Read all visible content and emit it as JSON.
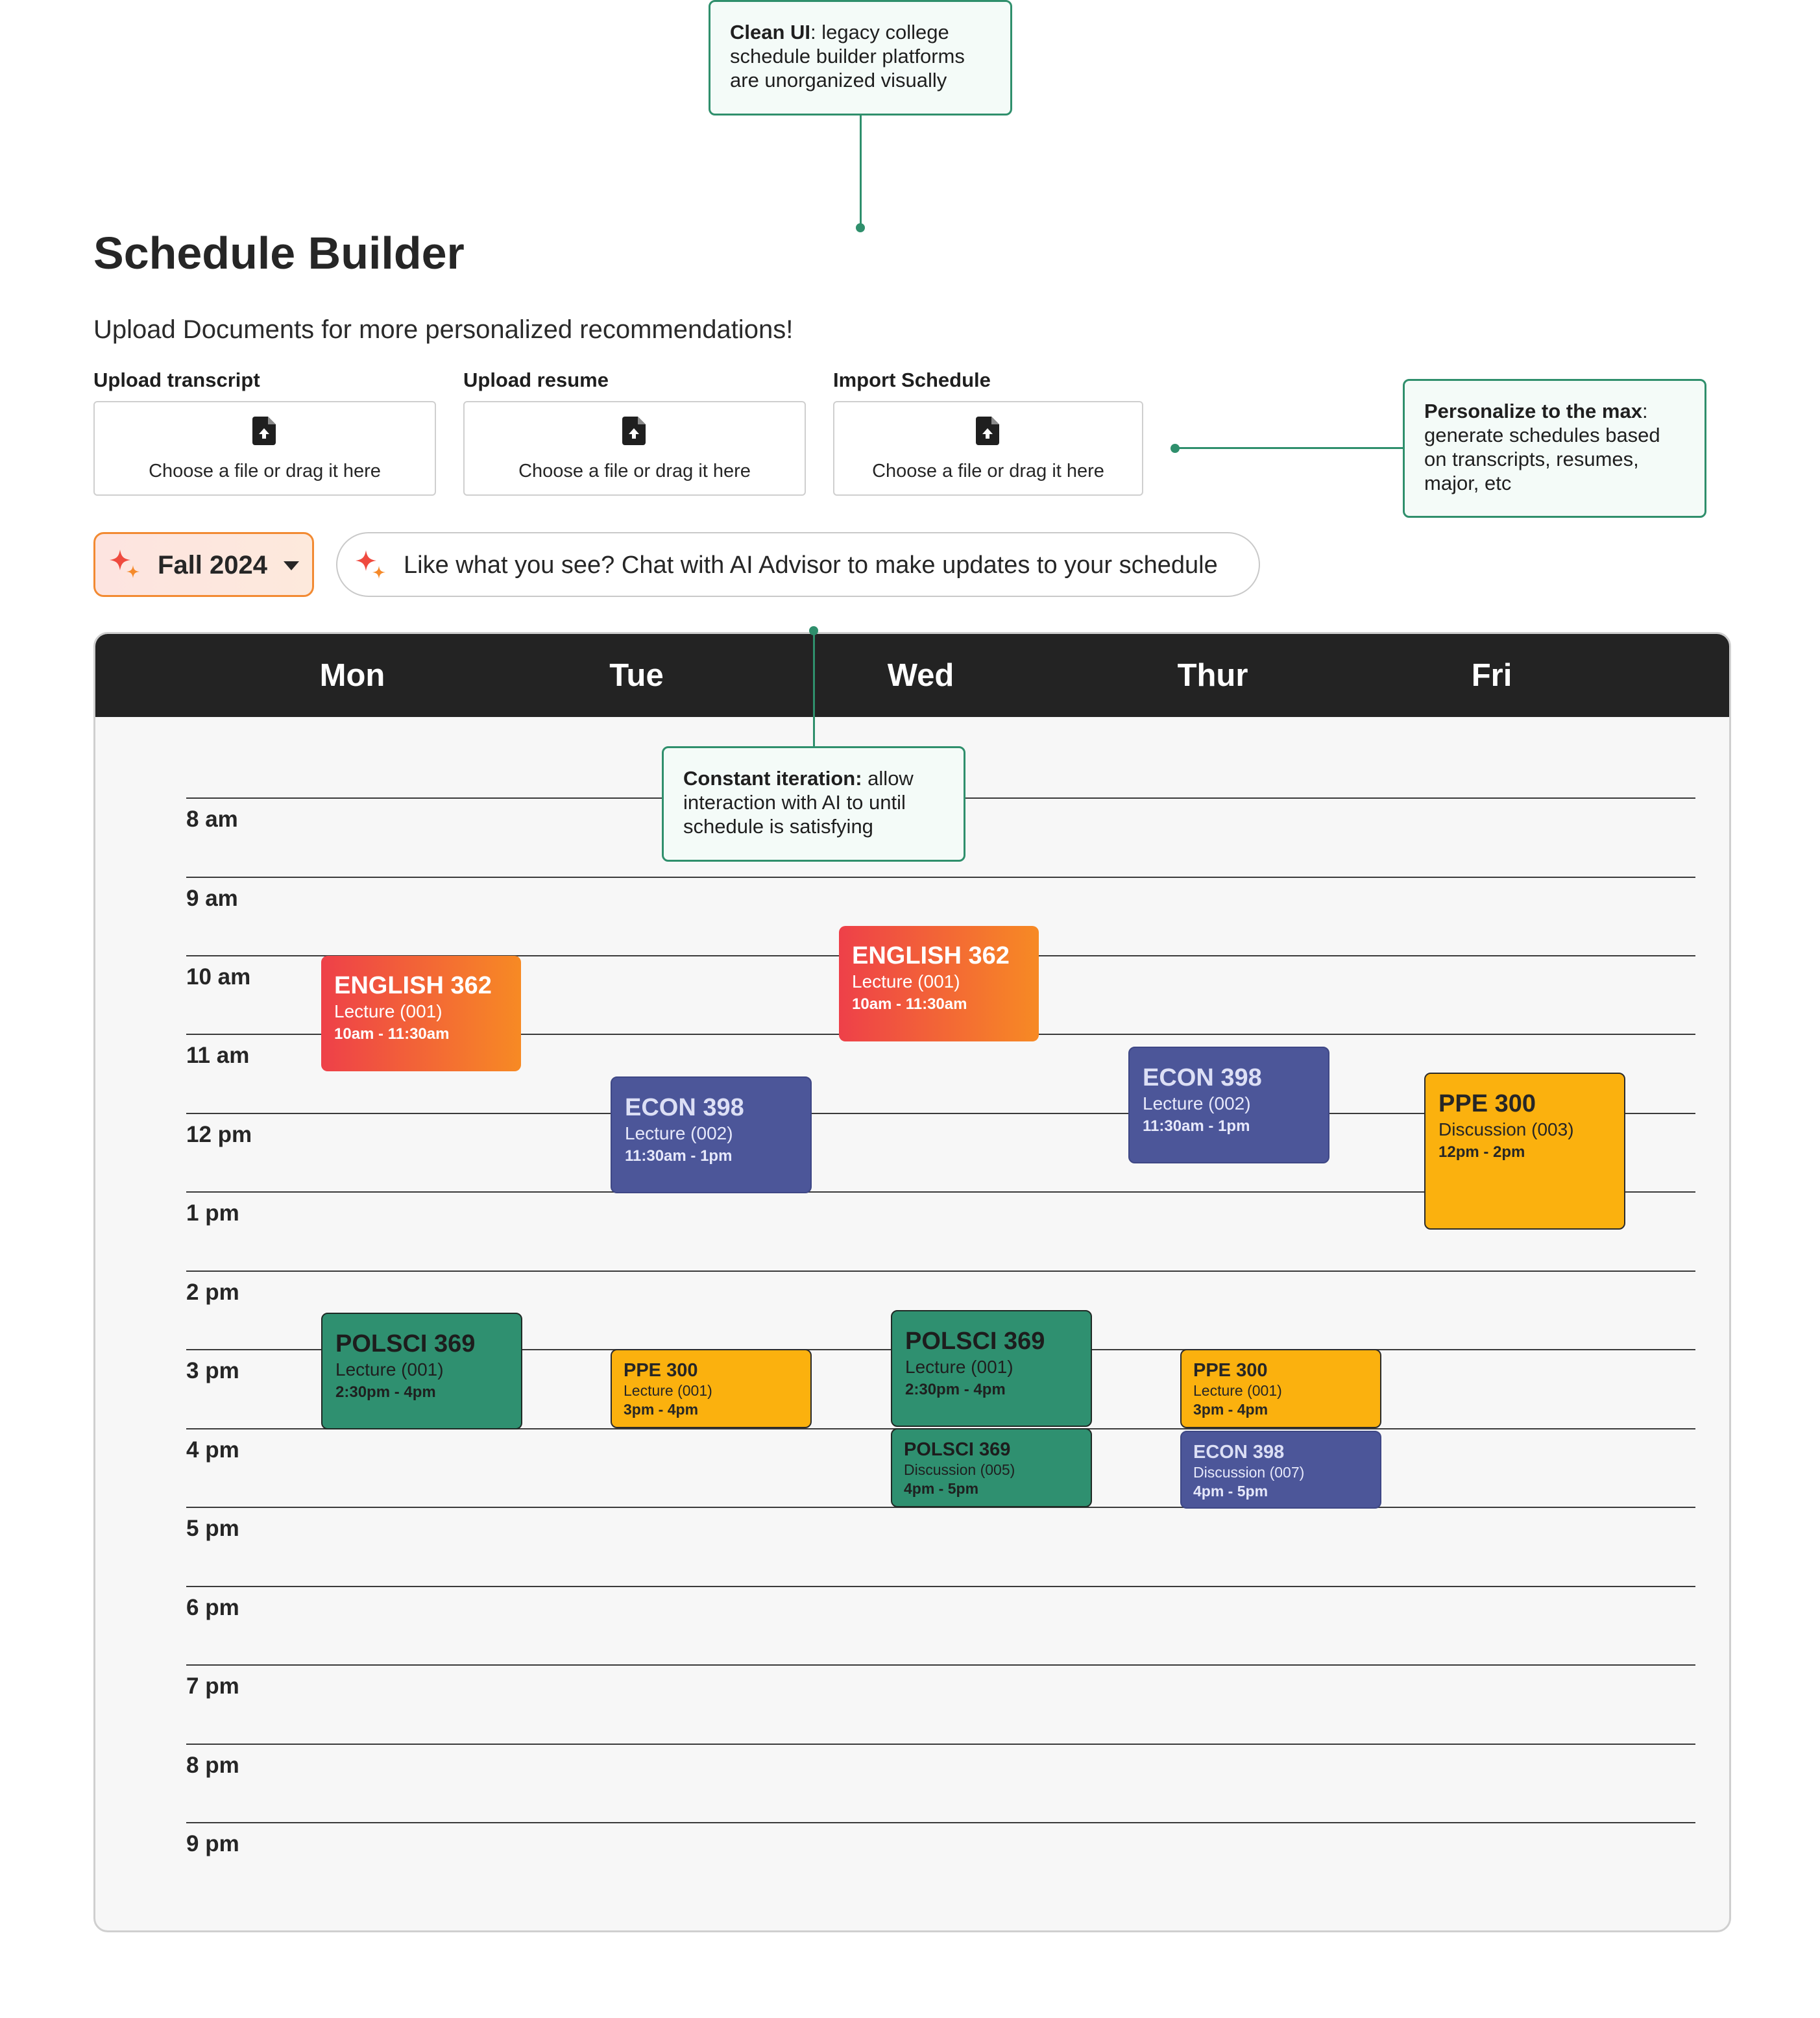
{
  "page": {
    "title": "Schedule Builder",
    "subtitle": "Upload Documents for more personalized recommendations!"
  },
  "uploads": [
    {
      "label": "Upload transcript",
      "prompt": "Choose a file or drag it here"
    },
    {
      "label": "Upload resume",
      "prompt": "Choose a file or drag it here"
    },
    {
      "label": "Import Schedule",
      "prompt": "Choose a file or drag it here"
    }
  ],
  "term": {
    "label": "Fall 2024",
    "icon": "sparkle-icon"
  },
  "chat": {
    "label": "Like what you see? Chat with AI Advisor to make updates to your schedule",
    "icon": "sparkle-icon"
  },
  "calendar": {
    "days": [
      "Mon",
      "Tue",
      "Wed",
      "Thur",
      "Fri"
    ],
    "hours": [
      "8 am",
      "9 am",
      "10 am",
      "11 am",
      "12 pm",
      "1 pm",
      "2 pm",
      "3 pm",
      "4 pm",
      "5 pm",
      "6 pm",
      "7 pm",
      "8 pm",
      "9 pm"
    ],
    "events": [
      {
        "code": "ENGLISH 362",
        "type": "Lecture (001)",
        "time": "10am - 11:30am"
      },
      {
        "code": "ENGLISH 362",
        "type": "Lecture (001)",
        "time": "10am - 11:30am"
      },
      {
        "code": "ECON 398",
        "type": "Lecture (002)",
        "time": "11:30am - 1pm"
      },
      {
        "code": "ECON 398",
        "type": "Lecture (002)",
        "time": "11:30am - 1pm"
      },
      {
        "code": "PPE 300",
        "type": "Discussion (003)",
        "time": "12pm - 2pm"
      },
      {
        "code": "POLSCI 369",
        "type": "Lecture (001)",
        "time": "2:30pm - 4pm"
      },
      {
        "code": "PPE 300",
        "type": "Lecture (001)",
        "time": "3pm - 4pm"
      },
      {
        "code": "POLSCI 369",
        "type": "Lecture (001)",
        "time": "2:30pm - 4pm"
      },
      {
        "code": "POLSCI 369",
        "type": "Discussion (005)",
        "time": "4pm - 5pm"
      },
      {
        "code": "PPE 300",
        "type": "Lecture (001)",
        "time": "3pm - 4pm"
      },
      {
        "code": "ECON 398",
        "type": "Discussion (007)",
        "time": "4pm - 5pm"
      }
    ]
  },
  "annotations": {
    "clean_ui": {
      "bold": "Clean UI",
      "text": ": legacy college schedule builder platforms are unorganized visually"
    },
    "personalize": {
      "bold": "Personalize to the max",
      "text": ": generate schedules based on transcripts, resumes, major, etc"
    },
    "iteration": {
      "bold": "Constant iteration:",
      "text": " allow interaction with AI to until schedule is satisfying"
    }
  },
  "colors": {
    "accent": "#2f8f6c",
    "english": "#ee4049",
    "econ": "#4c5699",
    "ppe": "#fbb10e",
    "polsci": "#2f9070"
  }
}
